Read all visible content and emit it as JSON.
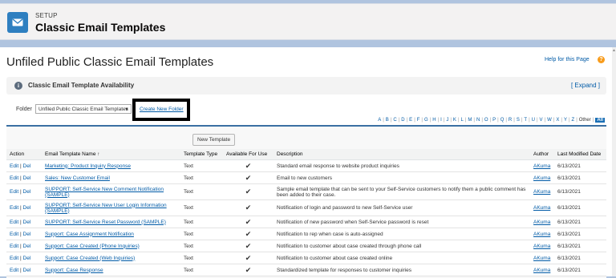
{
  "header": {
    "eyebrow": "SETUP",
    "title": "Classic Email Templates",
    "icon": "envelope-icon"
  },
  "page": {
    "title": "Unfiled Public Classic Email Templates",
    "help_link": "Help for this Page",
    "help_icon": "?"
  },
  "availability": {
    "label": "Classic Email Template Availability",
    "expand": "[ Expand ]",
    "info_icon": "i"
  },
  "folder": {
    "label": "Folder",
    "selected": "Unfiled Public Classic Email Templates",
    "create_link": "Create New Folder"
  },
  "alphabet": {
    "letters": [
      "A",
      "B",
      "C",
      "D",
      "E",
      "F",
      "G",
      "H",
      "I",
      "J",
      "K",
      "L",
      "M",
      "N",
      "O",
      "P",
      "Q",
      "R",
      "S",
      "T",
      "U",
      "V",
      "W",
      "X",
      "Y",
      "Z"
    ],
    "other": "Other",
    "all": "All"
  },
  "table": {
    "new_button": "New Template",
    "columns": [
      "Action",
      "Email Template Name",
      "Template Type",
      "Available For Use",
      "Description",
      "Author",
      "Last Modified Date"
    ],
    "sort_indicator": "↑",
    "edit_label": "Edit",
    "del_label": "Del",
    "rows": [
      {
        "name": "Marketing: Product Inquiry Response",
        "type": "Text",
        "available": "✔",
        "description": "Standard email response to website product inquiries",
        "author": "AKuma",
        "date": "6/13/2021"
      },
      {
        "name": "Sales: New Customer Email",
        "type": "Text",
        "available": "✔",
        "description": "Email to new customers",
        "author": "AKuma",
        "date": "6/13/2021"
      },
      {
        "name": "SUPPORT: Self-Service New Comment Notification (SAMPLE)",
        "type": "Text",
        "available": "✔",
        "description": "Sample email template that can be sent to your Self-Service customers to notify them a public comment has been added to their case.",
        "author": "AKuma",
        "date": "6/13/2021"
      },
      {
        "name": "SUPPORT: Self-Service New User Login Information (SAMPLE)",
        "type": "Text",
        "available": "✔",
        "description": "Notification of login and password to new Self-Service user",
        "author": "AKuma",
        "date": "6/13/2021"
      },
      {
        "name": "SUPPORT: Self-Service Reset Password (SAMPLE)",
        "type": "Text",
        "available": "✔",
        "description": "Notification of new password when Self-Service password is reset",
        "author": "AKuma",
        "date": "6/13/2021"
      },
      {
        "name": "Support: Case Assignment Notification",
        "type": "Text",
        "available": "✔",
        "description": "Notification to rep when case is auto-assigned",
        "author": "AKuma",
        "date": "6/13/2021"
      },
      {
        "name": "Support: Case Created (Phone Inquiries)",
        "type": "Text",
        "available": "✔",
        "description": "Notification to customer about case created through phone call",
        "author": "AKuma",
        "date": "6/13/2021"
      },
      {
        "name": "Support: Case Created (Web Inquiries)",
        "type": "Text",
        "available": "✔",
        "description": "Notification to customer about case created online",
        "author": "AKuma",
        "date": "6/13/2021"
      },
      {
        "name": "Support: Case Response",
        "type": "Text",
        "available": "✔",
        "description": "Standardized template for responses to customer inquiries",
        "author": "AKuma",
        "date": "6/13/2021"
      }
    ]
  }
}
